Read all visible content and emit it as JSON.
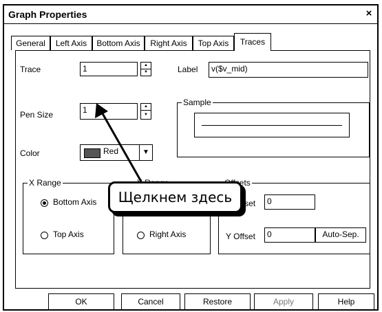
{
  "window": {
    "title": "Graph Properties",
    "close_glyph": "×"
  },
  "tabs": [
    {
      "label": "General"
    },
    {
      "label": "Left Axis"
    },
    {
      "label": "Bottom Axis"
    },
    {
      "label": "Right Axis"
    },
    {
      "label": "Top Axis"
    },
    {
      "label": "Traces",
      "active": true
    }
  ],
  "trace": {
    "label": "Trace",
    "value": "1"
  },
  "label_field": {
    "label": "Label",
    "value": "v($v_mid)"
  },
  "pen_size": {
    "label": "Pen Size",
    "value": "1"
  },
  "sample": {
    "title": "Sample"
  },
  "color": {
    "label": "Color",
    "value": "Red",
    "swatch": "#555555"
  },
  "x_range": {
    "title": "X Range",
    "bottom_axis": "Bottom Axis",
    "top_axis": "Top Axis",
    "selected": "Bottom Axis"
  },
  "y_range": {
    "title": "Y Range",
    "right_axis": "Right Axis"
  },
  "offsets": {
    "title": "Offsets",
    "x_offset_label": "X Offset",
    "x_offset_value": "0",
    "y_offset_label": "Y Offset",
    "y_offset_value": "0",
    "auto_sep": "Auto-Sep."
  },
  "buttons": {
    "ok": "OK",
    "cancel": "Cancel",
    "restore": "Restore",
    "apply": "Apply",
    "help": "Help"
  },
  "callout": {
    "text": "Щелкнем здесь"
  }
}
